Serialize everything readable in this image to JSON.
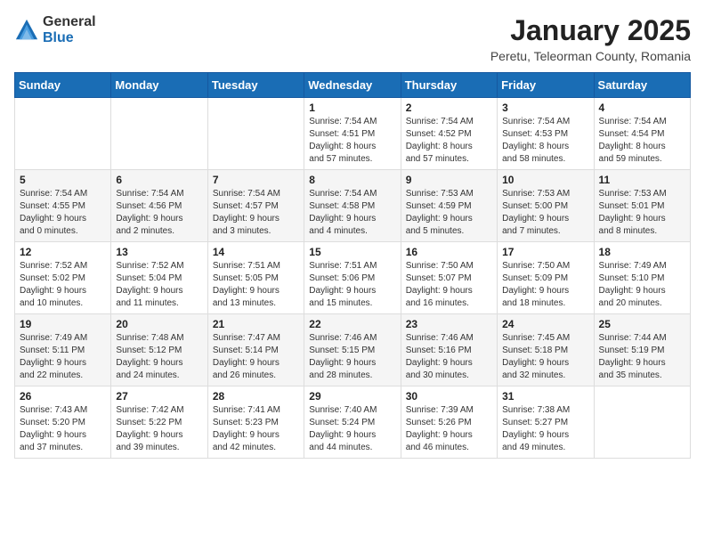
{
  "logo": {
    "general": "General",
    "blue": "Blue"
  },
  "title": "January 2025",
  "subtitle": "Peretu, Teleorman County, Romania",
  "days_of_week": [
    "Sunday",
    "Monday",
    "Tuesday",
    "Wednesday",
    "Thursday",
    "Friday",
    "Saturday"
  ],
  "weeks": [
    [
      {
        "day": "",
        "detail": ""
      },
      {
        "day": "",
        "detail": ""
      },
      {
        "day": "",
        "detail": ""
      },
      {
        "day": "1",
        "detail": "Sunrise: 7:54 AM\nSunset: 4:51 PM\nDaylight: 8 hours\nand 57 minutes."
      },
      {
        "day": "2",
        "detail": "Sunrise: 7:54 AM\nSunset: 4:52 PM\nDaylight: 8 hours\nand 57 minutes."
      },
      {
        "day": "3",
        "detail": "Sunrise: 7:54 AM\nSunset: 4:53 PM\nDaylight: 8 hours\nand 58 minutes."
      },
      {
        "day": "4",
        "detail": "Sunrise: 7:54 AM\nSunset: 4:54 PM\nDaylight: 8 hours\nand 59 minutes."
      }
    ],
    [
      {
        "day": "5",
        "detail": "Sunrise: 7:54 AM\nSunset: 4:55 PM\nDaylight: 9 hours\nand 0 minutes."
      },
      {
        "day": "6",
        "detail": "Sunrise: 7:54 AM\nSunset: 4:56 PM\nDaylight: 9 hours\nand 2 minutes."
      },
      {
        "day": "7",
        "detail": "Sunrise: 7:54 AM\nSunset: 4:57 PM\nDaylight: 9 hours\nand 3 minutes."
      },
      {
        "day": "8",
        "detail": "Sunrise: 7:54 AM\nSunset: 4:58 PM\nDaylight: 9 hours\nand 4 minutes."
      },
      {
        "day": "9",
        "detail": "Sunrise: 7:53 AM\nSunset: 4:59 PM\nDaylight: 9 hours\nand 5 minutes."
      },
      {
        "day": "10",
        "detail": "Sunrise: 7:53 AM\nSunset: 5:00 PM\nDaylight: 9 hours\nand 7 minutes."
      },
      {
        "day": "11",
        "detail": "Sunrise: 7:53 AM\nSunset: 5:01 PM\nDaylight: 9 hours\nand 8 minutes."
      }
    ],
    [
      {
        "day": "12",
        "detail": "Sunrise: 7:52 AM\nSunset: 5:02 PM\nDaylight: 9 hours\nand 10 minutes."
      },
      {
        "day": "13",
        "detail": "Sunrise: 7:52 AM\nSunset: 5:04 PM\nDaylight: 9 hours\nand 11 minutes."
      },
      {
        "day": "14",
        "detail": "Sunrise: 7:51 AM\nSunset: 5:05 PM\nDaylight: 9 hours\nand 13 minutes."
      },
      {
        "day": "15",
        "detail": "Sunrise: 7:51 AM\nSunset: 5:06 PM\nDaylight: 9 hours\nand 15 minutes."
      },
      {
        "day": "16",
        "detail": "Sunrise: 7:50 AM\nSunset: 5:07 PM\nDaylight: 9 hours\nand 16 minutes."
      },
      {
        "day": "17",
        "detail": "Sunrise: 7:50 AM\nSunset: 5:09 PM\nDaylight: 9 hours\nand 18 minutes."
      },
      {
        "day": "18",
        "detail": "Sunrise: 7:49 AM\nSunset: 5:10 PM\nDaylight: 9 hours\nand 20 minutes."
      }
    ],
    [
      {
        "day": "19",
        "detail": "Sunrise: 7:49 AM\nSunset: 5:11 PM\nDaylight: 9 hours\nand 22 minutes."
      },
      {
        "day": "20",
        "detail": "Sunrise: 7:48 AM\nSunset: 5:12 PM\nDaylight: 9 hours\nand 24 minutes."
      },
      {
        "day": "21",
        "detail": "Sunrise: 7:47 AM\nSunset: 5:14 PM\nDaylight: 9 hours\nand 26 minutes."
      },
      {
        "day": "22",
        "detail": "Sunrise: 7:46 AM\nSunset: 5:15 PM\nDaylight: 9 hours\nand 28 minutes."
      },
      {
        "day": "23",
        "detail": "Sunrise: 7:46 AM\nSunset: 5:16 PM\nDaylight: 9 hours\nand 30 minutes."
      },
      {
        "day": "24",
        "detail": "Sunrise: 7:45 AM\nSunset: 5:18 PM\nDaylight: 9 hours\nand 32 minutes."
      },
      {
        "day": "25",
        "detail": "Sunrise: 7:44 AM\nSunset: 5:19 PM\nDaylight: 9 hours\nand 35 minutes."
      }
    ],
    [
      {
        "day": "26",
        "detail": "Sunrise: 7:43 AM\nSunset: 5:20 PM\nDaylight: 9 hours\nand 37 minutes."
      },
      {
        "day": "27",
        "detail": "Sunrise: 7:42 AM\nSunset: 5:22 PM\nDaylight: 9 hours\nand 39 minutes."
      },
      {
        "day": "28",
        "detail": "Sunrise: 7:41 AM\nSunset: 5:23 PM\nDaylight: 9 hours\nand 42 minutes."
      },
      {
        "day": "29",
        "detail": "Sunrise: 7:40 AM\nSunset: 5:24 PM\nDaylight: 9 hours\nand 44 minutes."
      },
      {
        "day": "30",
        "detail": "Sunrise: 7:39 AM\nSunset: 5:26 PM\nDaylight: 9 hours\nand 46 minutes."
      },
      {
        "day": "31",
        "detail": "Sunrise: 7:38 AM\nSunset: 5:27 PM\nDaylight: 9 hours\nand 49 minutes."
      },
      {
        "day": "",
        "detail": ""
      }
    ]
  ]
}
